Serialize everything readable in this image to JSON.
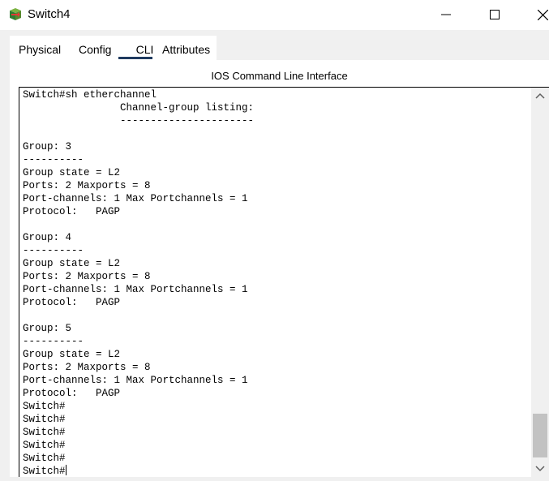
{
  "window": {
    "title": "Switch4"
  },
  "tabs": [
    {
      "label": "Physical"
    },
    {
      "label": "Config"
    },
    {
      "label": "CLI",
      "active": true
    },
    {
      "label": "Attributes"
    }
  ],
  "panel": {
    "heading": "IOS Command Line Interface"
  },
  "console": {
    "lines": [
      "Switch#sh etherchannel",
      "                Channel-group listing:",
      "                ----------------------",
      "",
      "Group: 3",
      "----------",
      "Group state = L2",
      "Ports: 2 Maxports = 8",
      "Port-channels: 1 Max Portchannels = 1",
      "Protocol:   PAGP",
      "",
      "Group: 4",
      "----------",
      "Group state = L2",
      "Ports: 2 Maxports = 8",
      "Port-channels: 1 Max Portchannels = 1",
      "Protocol:   PAGP",
      "",
      "Group: 5",
      "----------",
      "Group state = L2",
      "Ports: 2 Maxports = 8",
      "Port-channels: 1 Max Portchannels = 1",
      "Protocol:   PAGP",
      "Switch#",
      "Switch#",
      "Switch#",
      "Switch#",
      "Switch#"
    ],
    "prompt": "Switch#"
  },
  "icons": {
    "app": "packet-tracer-device-icon",
    "minimize": "minimize-icon",
    "maximize": "maximize-icon",
    "close": "close-icon",
    "scroll_up": "chevron-up-icon",
    "scroll_down": "chevron-down-icon"
  },
  "colors": {
    "active_tab_underline": "#1f3a60",
    "scroll_thumb": "#c2c2c2"
  }
}
